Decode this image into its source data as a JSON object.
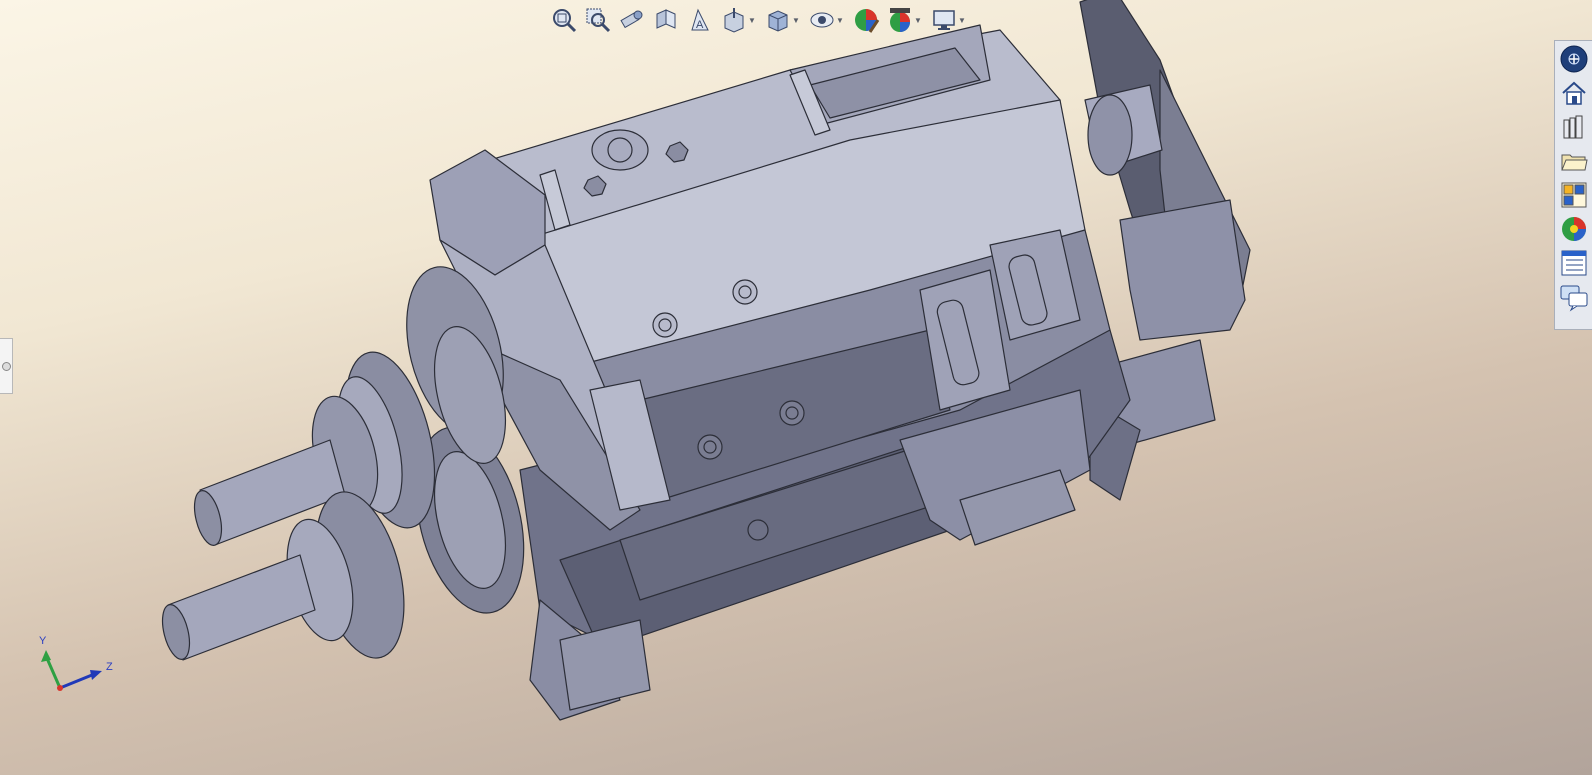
{
  "heads_up_toolbar": [
    {
      "icon": "zoom-to-fit-icon"
    },
    {
      "icon": "zoom-to-area-icon"
    },
    {
      "icon": "previous-view-icon"
    },
    {
      "icon": "section-view-icon"
    },
    {
      "icon": "view-palette-icon"
    },
    {
      "icon": "view-orientation-icon",
      "dropdown": true
    },
    {
      "icon": "display-style-icon",
      "dropdown": true
    },
    {
      "icon": "hide-show-items-icon",
      "dropdown": true
    },
    {
      "icon": "edit-appearance-icon"
    },
    {
      "icon": "apply-scene-icon",
      "dropdown": true
    },
    {
      "icon": "view-settings-icon",
      "dropdown": true
    }
  ],
  "task_pane": [
    {
      "icon": "solidworks-resources-icon"
    },
    {
      "icon": "home-icon"
    },
    {
      "icon": "design-library-icon"
    },
    {
      "icon": "file-explorer-icon"
    },
    {
      "icon": "view-palette-pane-icon"
    },
    {
      "icon": "appearances-scenes-icon"
    },
    {
      "icon": "custom-properties-icon"
    },
    {
      "icon": "forum-icon"
    }
  ],
  "triad": {
    "y_label": "Y",
    "z_label": "Z"
  },
  "colors": {
    "model": "#9ea1b8",
    "background_top": "#fbf5e6",
    "background_bottom": "#b2a49b"
  }
}
